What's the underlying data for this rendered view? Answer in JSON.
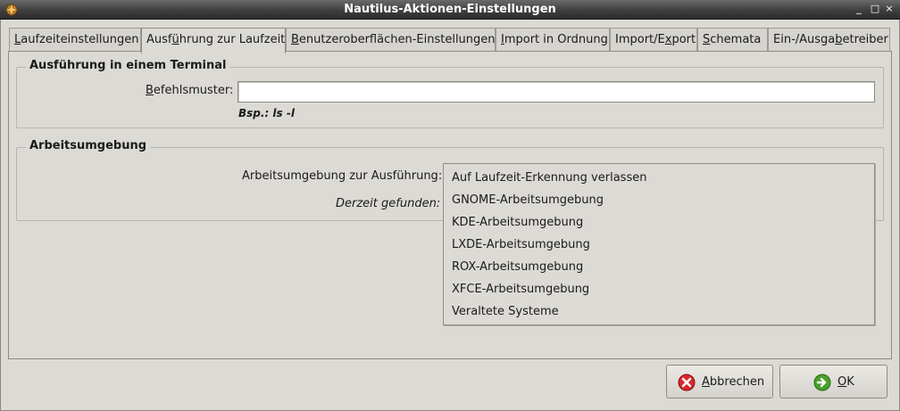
{
  "window": {
    "title": "Nautilus-Aktionen-Einstellungen",
    "controls": {
      "minimize": "_",
      "maximize": "□",
      "close": "×"
    }
  },
  "tabs": [
    {
      "pre": "",
      "key": "L",
      "post": "aufzeiteinstellungen"
    },
    {
      "pre": "Ausf",
      "key": "ü",
      "post": "hrung zur Laufzeit"
    },
    {
      "pre": "",
      "key": "B",
      "post": "enutzeroberflächen-Einstellungen"
    },
    {
      "pre": "",
      "key": "I",
      "post": "mport in Ordnung"
    },
    {
      "pre": "Import/E",
      "key": "x",
      "post": "port"
    },
    {
      "pre": "",
      "key": "S",
      "post": "chemata"
    },
    {
      "pre": "Ein-/Ausga",
      "key": "b",
      "post": "etreiber"
    }
  ],
  "terminal_group": {
    "title": "Ausführung in einem Terminal",
    "pattern_label_key": "B",
    "pattern_label_rest": "efehlsmuster:",
    "pattern_value": "",
    "hint": "Bsp.: ls -l"
  },
  "desktop_group": {
    "title": "Arbeitsumgebung",
    "env_label": "Arbeitsumgebung zur Ausführung:",
    "found_label": "Derzeit gefunden:",
    "options": [
      "Auf Laufzeit-Erkennung verlassen",
      "GNOME-Arbeitsumgebung",
      "KDE-Arbeitsumgebung",
      "LXDE-Arbeitsumgebung",
      "ROX-Arbeitsumgebung",
      "XFCE-Arbeitsumgebung",
      "Veraltete Systeme"
    ]
  },
  "buttons": {
    "cancel": {
      "key": "A",
      "rest": "bbrechen",
      "icon": "cancel-icon"
    },
    "ok": {
      "key": "O",
      "rest": "K",
      "icon": "ok-icon"
    }
  },
  "colors": {
    "cancel_icon": "#d9262b",
    "ok_icon": "#4aa02c"
  }
}
